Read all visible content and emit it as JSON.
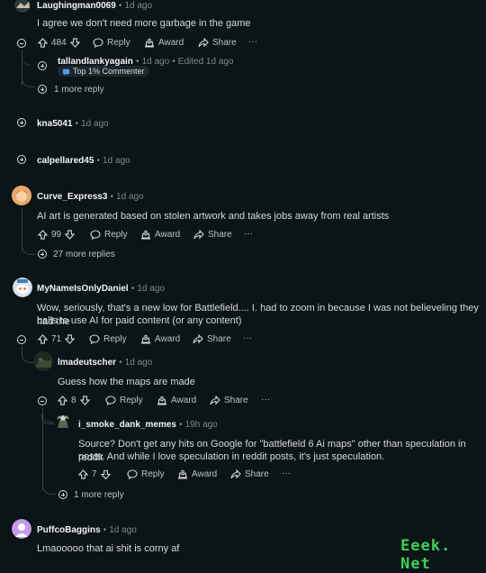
{
  "comments": [
    {
      "username": "Laughingman0069",
      "time": "1d ago",
      "text": "I agree we don't need more garbage in the game",
      "votes": "484",
      "actions": {
        "reply": "Reply",
        "award": "Award",
        "share": "Share",
        "more": "···"
      },
      "child": {
        "username": "tallandlankyagain",
        "time": "1d ago",
        "edited": "Edited 1d ago",
        "badge": "Top 1% Commenter"
      },
      "more_replies": "1 more reply"
    },
    {
      "username": "kna5041",
      "time": "1d ago"
    },
    {
      "username": "calpellared45",
      "time": "1d ago"
    },
    {
      "username": "Curve_Express3",
      "time": "1d ago",
      "text": "AI art is generated based on stolen artwork and takes jobs away from real artists",
      "votes": "99",
      "actions": {
        "reply": "Reply",
        "award": "Award",
        "share": "Share",
        "more": "···"
      },
      "more_replies": "27 more replies"
    },
    {
      "username": "MyNameIsOnlyDaniel",
      "time": "1d ago",
      "text_line1": "Wow, seriously, that's a new low for Battlefield.... I. had to zoom in because I was not believeling they had the",
      "text_line2": "balls to use AI for paid content (or any content)",
      "votes": "71",
      "actions": {
        "reply": "Reply",
        "award": "Award",
        "share": "Share",
        "more": "···"
      },
      "child": {
        "username": "lmadeutscher",
        "time": "1d ago",
        "text": "Guess how the maps are made",
        "votes": "8",
        "actions": {
          "reply": "Reply",
          "award": "Award",
          "share": "Share",
          "more": "···"
        },
        "child": {
          "username": "i_smoke_dank_memes",
          "time": "19h ago",
          "text_line1": "Source? Don't get any hits on Google for \"battlefield 6 Ai maps\" other than speculation in reddit",
          "text_line2": "posts. And while I love speculation in reddit posts, it's just speculation.",
          "votes": "7",
          "actions": {
            "reply": "Reply",
            "award": "Award",
            "share": "Share",
            "more": "···"
          }
        },
        "more_replies": "1 more reply"
      }
    },
    {
      "username": "PuffcoBaggins",
      "time": "1d ago",
      "text": "Lmaooooo that ai shit is corny af"
    }
  ],
  "watermark": "Eeek. Net",
  "dot": "•"
}
